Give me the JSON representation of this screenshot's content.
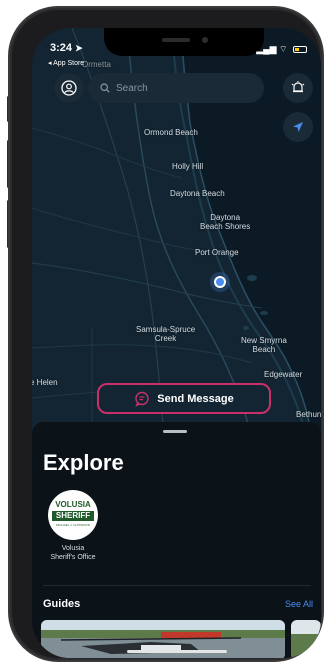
{
  "status": {
    "time": "3:24",
    "back_app": "◂ App Store"
  },
  "search": {
    "placeholder": "Search"
  },
  "map": {
    "places": [
      {
        "name": "Ormond Beach"
      },
      {
        "name": "Holly Hill"
      },
      {
        "name": "Daytona Beach"
      },
      {
        "name": "Daytona\nBeach Shores"
      },
      {
        "name": "Port Orange"
      },
      {
        "name": "Samsula-Spruce\nCreek"
      },
      {
        "name": "New Smyrna\nBeach"
      },
      {
        "name": "Edgewater"
      },
      {
        "name": "e Helen"
      },
      {
        "name": "Bethune"
      },
      {
        "name": "Ormetta"
      }
    ]
  },
  "actions": {
    "send_message": "Send Message"
  },
  "explore": {
    "title": "Explore",
    "orgs": [
      {
        "name": "Volusia Sheriff's Office",
        "logo_top": "VOLUSIA",
        "logo_band": "SHERIFF",
        "logo_bottom": "MICHAEL J. CHITWOOD"
      }
    ]
  },
  "guides": {
    "title": "Guides",
    "see_all": "See All"
  },
  "colors": {
    "accent": "#4a8cf0",
    "send_border": "#c8306b",
    "map_bg": "#132532"
  }
}
